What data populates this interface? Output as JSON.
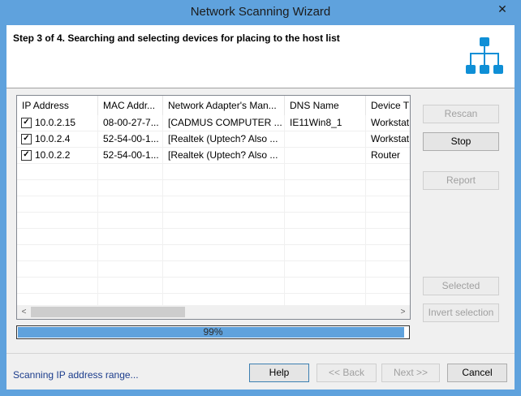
{
  "window": {
    "title": "Network Scanning Wizard",
    "close_glyph": "✕"
  },
  "header": {
    "step_text": "Step 3 of 4. Searching and selecting devices for placing to the host list",
    "icon": "network-topology-icon",
    "icon_color": "#0f8fd6"
  },
  "table": {
    "columns": [
      "IP Address",
      "MAC Addr...",
      "Network Adapter's Man...",
      "DNS Name",
      "Device T"
    ],
    "rows": [
      {
        "checked": true,
        "ip": "10.0.2.15",
        "mac": "08-00-27-7...",
        "adapter": "[CADMUS COMPUTER ...",
        "dns": "IE11Win8_1",
        "device": "Workstat"
      },
      {
        "checked": true,
        "ip": "10.0.2.4",
        "mac": "52-54-00-1...",
        "adapter": "[Realtek (Uptech? Also ...",
        "dns": "",
        "device": "Workstat"
      },
      {
        "checked": true,
        "ip": "10.0.2.2",
        "mac": "52-54-00-1...",
        "adapter": "[Realtek (Uptech? Also ...",
        "dns": "",
        "device": "Router"
      }
    ],
    "checkbox_glyph": "✓"
  },
  "scrollbar": {
    "left_arrow": "<",
    "right_arrow": ">"
  },
  "side_buttons": {
    "rescan": "Rescan",
    "stop": "Stop",
    "report": "Report",
    "selected": "Selected",
    "invert": "Invert selection"
  },
  "progress": {
    "value": 0.99,
    "label": "99%"
  },
  "footer": {
    "status": "Scanning IP address range...",
    "help": "Help",
    "back": "<< Back",
    "next": "Next >>",
    "cancel": "Cancel"
  },
  "colors": {
    "titlebar": "#5fa2dd",
    "accent": "#0f8fd6"
  }
}
